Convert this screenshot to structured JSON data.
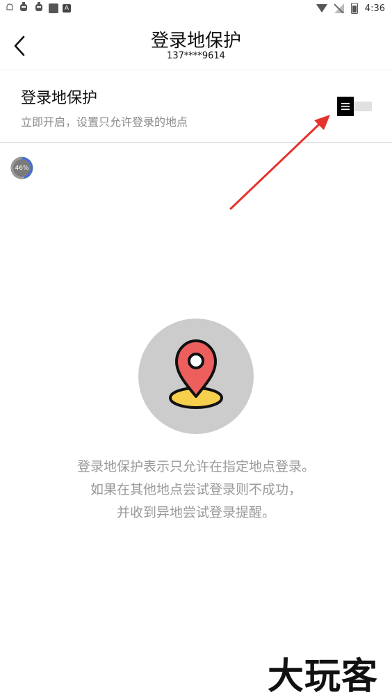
{
  "status_bar": {
    "time": "4:36",
    "left_icons": [
      "notification-icon",
      "bug-icon",
      "bug-icon",
      "square-icon",
      "app-a-icon"
    ],
    "right_icons": [
      "wifi-icon",
      "no-signal-icon",
      "battery-icon"
    ]
  },
  "header": {
    "title": "登录地保护",
    "subtitle": "137****9614"
  },
  "setting": {
    "title": "登录地保护",
    "description": "立即开启，设置只允许登录的地点",
    "toggle_state": "off"
  },
  "progress_badge": {
    "label": "46%",
    "value": 46
  },
  "info": {
    "line1": "登录地保护表示只允许在指定地点登录。",
    "line2": "如果在其他地点尝试登录则不成功，",
    "line3": "并收到异地尝试登录提醒。"
  },
  "watermark": {
    "text": "大玩客"
  },
  "colors": {
    "accent_red": "#e5322d",
    "pin_red": "#ec5f5d",
    "pin_yellow": "#f6d04d",
    "circle_gray": "#cccccc",
    "info_gray": "#9a9a9a"
  }
}
